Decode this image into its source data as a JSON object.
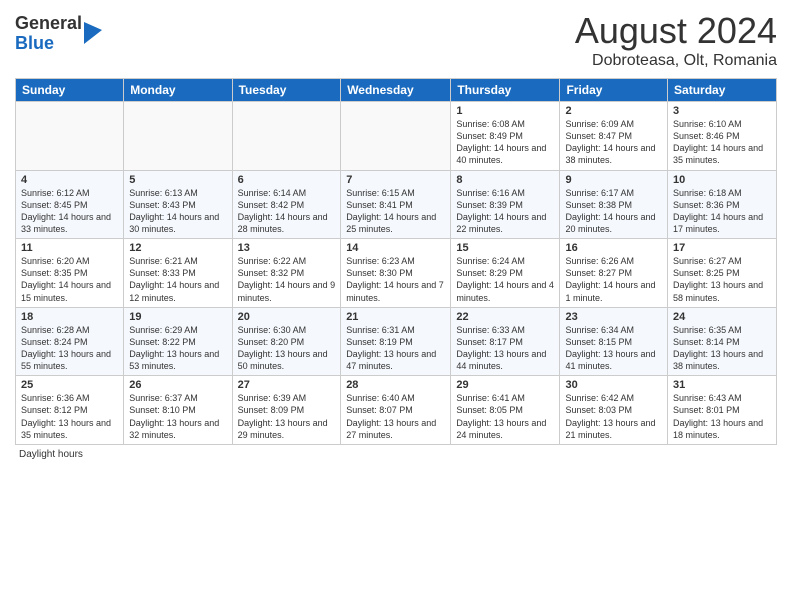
{
  "header": {
    "logo_general": "General",
    "logo_blue": "Blue",
    "month_title": "August 2024",
    "location": "Dobroteasa, Olt, Romania"
  },
  "days_of_week": [
    "Sunday",
    "Monday",
    "Tuesday",
    "Wednesday",
    "Thursday",
    "Friday",
    "Saturday"
  ],
  "weeks": [
    [
      {
        "day": "",
        "info": ""
      },
      {
        "day": "",
        "info": ""
      },
      {
        "day": "",
        "info": ""
      },
      {
        "day": "",
        "info": ""
      },
      {
        "day": "1",
        "info": "Sunrise: 6:08 AM\nSunset: 8:49 PM\nDaylight: 14 hours\nand 40 minutes."
      },
      {
        "day": "2",
        "info": "Sunrise: 6:09 AM\nSunset: 8:47 PM\nDaylight: 14 hours\nand 38 minutes."
      },
      {
        "day": "3",
        "info": "Sunrise: 6:10 AM\nSunset: 8:46 PM\nDaylight: 14 hours\nand 35 minutes."
      }
    ],
    [
      {
        "day": "4",
        "info": "Sunrise: 6:12 AM\nSunset: 8:45 PM\nDaylight: 14 hours\nand 33 minutes."
      },
      {
        "day": "5",
        "info": "Sunrise: 6:13 AM\nSunset: 8:43 PM\nDaylight: 14 hours\nand 30 minutes."
      },
      {
        "day": "6",
        "info": "Sunrise: 6:14 AM\nSunset: 8:42 PM\nDaylight: 14 hours\nand 28 minutes."
      },
      {
        "day": "7",
        "info": "Sunrise: 6:15 AM\nSunset: 8:41 PM\nDaylight: 14 hours\nand 25 minutes."
      },
      {
        "day": "8",
        "info": "Sunrise: 6:16 AM\nSunset: 8:39 PM\nDaylight: 14 hours\nand 22 minutes."
      },
      {
        "day": "9",
        "info": "Sunrise: 6:17 AM\nSunset: 8:38 PM\nDaylight: 14 hours\nand 20 minutes."
      },
      {
        "day": "10",
        "info": "Sunrise: 6:18 AM\nSunset: 8:36 PM\nDaylight: 14 hours\nand 17 minutes."
      }
    ],
    [
      {
        "day": "11",
        "info": "Sunrise: 6:20 AM\nSunset: 8:35 PM\nDaylight: 14 hours\nand 15 minutes."
      },
      {
        "day": "12",
        "info": "Sunrise: 6:21 AM\nSunset: 8:33 PM\nDaylight: 14 hours\nand 12 minutes."
      },
      {
        "day": "13",
        "info": "Sunrise: 6:22 AM\nSunset: 8:32 PM\nDaylight: 14 hours\nand 9 minutes."
      },
      {
        "day": "14",
        "info": "Sunrise: 6:23 AM\nSunset: 8:30 PM\nDaylight: 14 hours\nand 7 minutes."
      },
      {
        "day": "15",
        "info": "Sunrise: 6:24 AM\nSunset: 8:29 PM\nDaylight: 14 hours\nand 4 minutes."
      },
      {
        "day": "16",
        "info": "Sunrise: 6:26 AM\nSunset: 8:27 PM\nDaylight: 14 hours\nand 1 minute."
      },
      {
        "day": "17",
        "info": "Sunrise: 6:27 AM\nSunset: 8:25 PM\nDaylight: 13 hours\nand 58 minutes."
      }
    ],
    [
      {
        "day": "18",
        "info": "Sunrise: 6:28 AM\nSunset: 8:24 PM\nDaylight: 13 hours\nand 55 minutes."
      },
      {
        "day": "19",
        "info": "Sunrise: 6:29 AM\nSunset: 8:22 PM\nDaylight: 13 hours\nand 53 minutes."
      },
      {
        "day": "20",
        "info": "Sunrise: 6:30 AM\nSunset: 8:20 PM\nDaylight: 13 hours\nand 50 minutes."
      },
      {
        "day": "21",
        "info": "Sunrise: 6:31 AM\nSunset: 8:19 PM\nDaylight: 13 hours\nand 47 minutes."
      },
      {
        "day": "22",
        "info": "Sunrise: 6:33 AM\nSunset: 8:17 PM\nDaylight: 13 hours\nand 44 minutes."
      },
      {
        "day": "23",
        "info": "Sunrise: 6:34 AM\nSunset: 8:15 PM\nDaylight: 13 hours\nand 41 minutes."
      },
      {
        "day": "24",
        "info": "Sunrise: 6:35 AM\nSunset: 8:14 PM\nDaylight: 13 hours\nand 38 minutes."
      }
    ],
    [
      {
        "day": "25",
        "info": "Sunrise: 6:36 AM\nSunset: 8:12 PM\nDaylight: 13 hours\nand 35 minutes."
      },
      {
        "day": "26",
        "info": "Sunrise: 6:37 AM\nSunset: 8:10 PM\nDaylight: 13 hours\nand 32 minutes."
      },
      {
        "day": "27",
        "info": "Sunrise: 6:39 AM\nSunset: 8:09 PM\nDaylight: 13 hours\nand 29 minutes."
      },
      {
        "day": "28",
        "info": "Sunrise: 6:40 AM\nSunset: 8:07 PM\nDaylight: 13 hours\nand 27 minutes."
      },
      {
        "day": "29",
        "info": "Sunrise: 6:41 AM\nSunset: 8:05 PM\nDaylight: 13 hours\nand 24 minutes."
      },
      {
        "day": "30",
        "info": "Sunrise: 6:42 AM\nSunset: 8:03 PM\nDaylight: 13 hours\nand 21 minutes."
      },
      {
        "day": "31",
        "info": "Sunrise: 6:43 AM\nSunset: 8:01 PM\nDaylight: 13 hours\nand 18 minutes."
      }
    ]
  ],
  "footer": {
    "note": "Daylight hours"
  }
}
